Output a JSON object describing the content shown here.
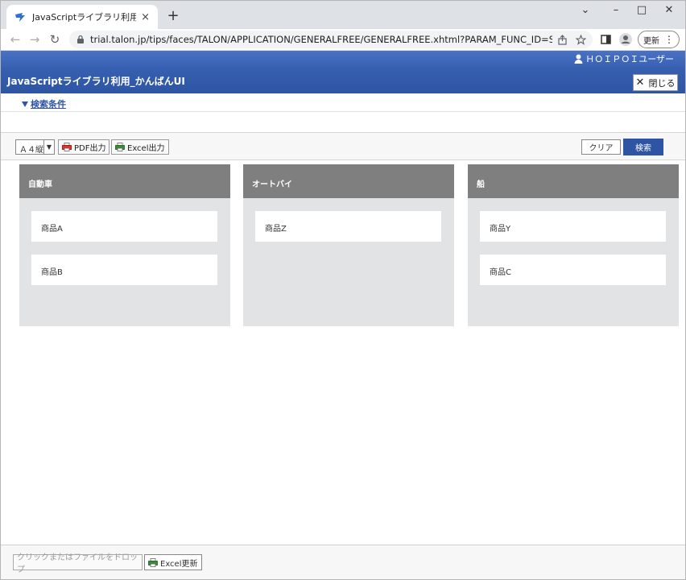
{
  "browser": {
    "tab_title": "JavaScriptライブラリ利用_かんばんUI",
    "tab_close": "×",
    "new_tab": "+",
    "url": "trial.talon.jp/tips/faces/TALON/APPLICATION/GENERALFREE/GENERALFREE.xhtml?PARAM_FUNC_ID=SCREEN_SAM...",
    "update_label": "更新",
    "minimize": "–",
    "maximize": "□",
    "close": "✕",
    "chevron": "⌄",
    "back": "←",
    "forward": "→",
    "reload": "↻",
    "menu": "⋮",
    "share_icon": "share-icon",
    "star_icon": "star-icon"
  },
  "app": {
    "user_name": "ＨＯＩＰＯＩユーザー",
    "title": "JavaScriptライブラリ利用_かんばんUI",
    "close_label": "閉じる",
    "search_conditions": "検索条件"
  },
  "toolbar": {
    "page_size": "Ａ４縦",
    "pdf_label": "PDF出力",
    "excel_label": "Excel出力",
    "clear_label": "クリア",
    "search_label": "検索"
  },
  "kanban": {
    "columns": [
      {
        "title": "自動車",
        "cards": [
          "商品A",
          "商品B"
        ]
      },
      {
        "title": "オートバイ",
        "cards": [
          "商品Z"
        ]
      },
      {
        "title": "船",
        "cards": [
          "商品Y",
          "商品C"
        ]
      }
    ]
  },
  "footer": {
    "drop_label": "クリックまたはファイルをドロップ",
    "excel_update_label": "Excel更新"
  },
  "colors": {
    "header_blue": "#2e55a4",
    "column_header": "#7f7f7f",
    "column_bg": "#e2e3e5"
  }
}
